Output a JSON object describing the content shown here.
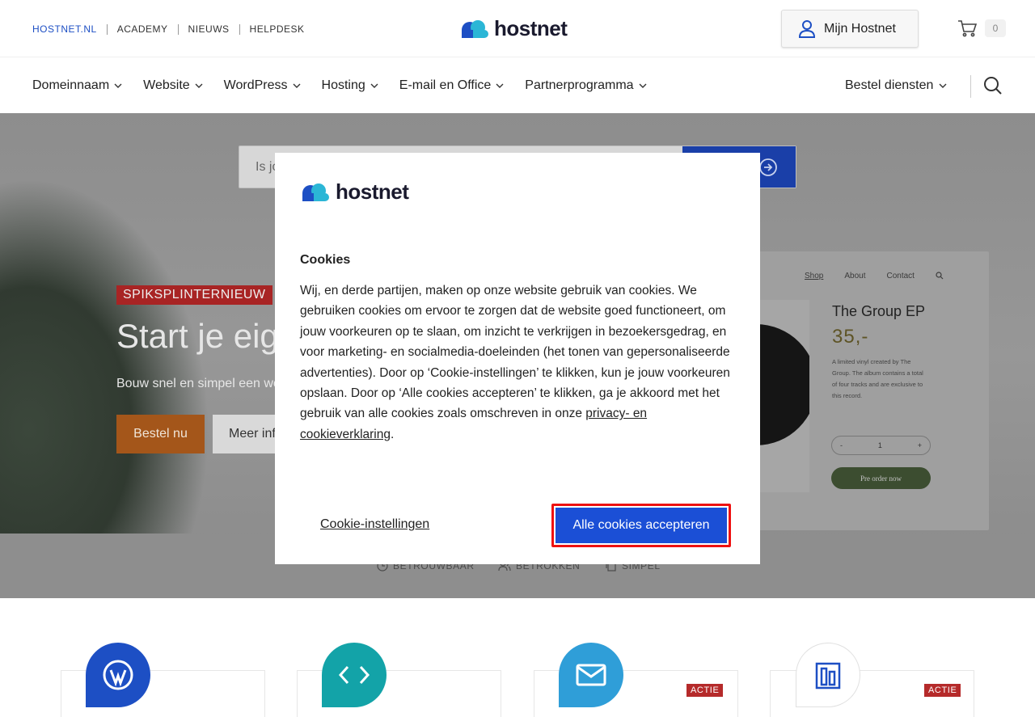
{
  "topbar": {
    "links": [
      "HOSTNET.NL",
      "ACADEMY",
      "NIEUWS",
      "HELPDESK"
    ],
    "logo_text": "hostnet",
    "account_label": "Mijn Hostnet",
    "cart_count": "0"
  },
  "nav": {
    "items": [
      "Domeinnaam",
      "Website",
      "WordPress",
      "Hosting",
      "E-mail en Office",
      "Partnerprogramma"
    ],
    "order_services": "Bestel diensten"
  },
  "hero": {
    "search_placeholder": "Is jo",
    "badge": "SPIKSPLINTERNIEUW",
    "title": "Start je eig",
    "subtitle": "Bouw snel en simpel een we",
    "order_label": "Bestel nu",
    "more_label": "Meer inf",
    "shop": {
      "nav": [
        "Shop",
        "About",
        "Contact"
      ],
      "title": "The Group EP",
      "price": "35,-",
      "description": "A limited vinyl created by The Group. The album contains a total of four tracks and are exclusive to this record.",
      "qty_minus": "-",
      "qty_value": "1",
      "qty_plus": "+",
      "preorder": "Pre order now"
    },
    "usps": [
      "BETROUWBAAR",
      "BETROKKEN",
      "SIMPEL"
    ]
  },
  "cards": {
    "actie_label": "ACTIE",
    "colors": [
      "#1d4fc4",
      "#13a3a8",
      "#2f9ed8",
      "#ffffff"
    ]
  },
  "cookie_modal": {
    "logo_text": "hostnet",
    "title": "Cookies",
    "body": "Wij, en derde partijen, maken op onze website gebruik van cookies. We gebruiken cookies om ervoor te zorgen dat de website goed functioneert, om jouw voorkeuren op te slaan, om inzicht te verkrijgen in bezoekersgedrag, en voor marketing- en socialmedia-doeleinden (het tonen van gepersonaliseerde advertenties). Door op ‘Cookie-instellingen’ te klikken, kun je jouw voorkeuren opslaan. Door op ‘Alle cookies accepteren’ te klikken, ga je akkoord met het gebruik van alle cookies zoals omschreven in onze ",
    "privacy_link": "privacy- en cookieverklaring",
    "body_end": ".",
    "settings_label": "Cookie-instellingen",
    "accept_label": "Alle cookies accepteren"
  }
}
